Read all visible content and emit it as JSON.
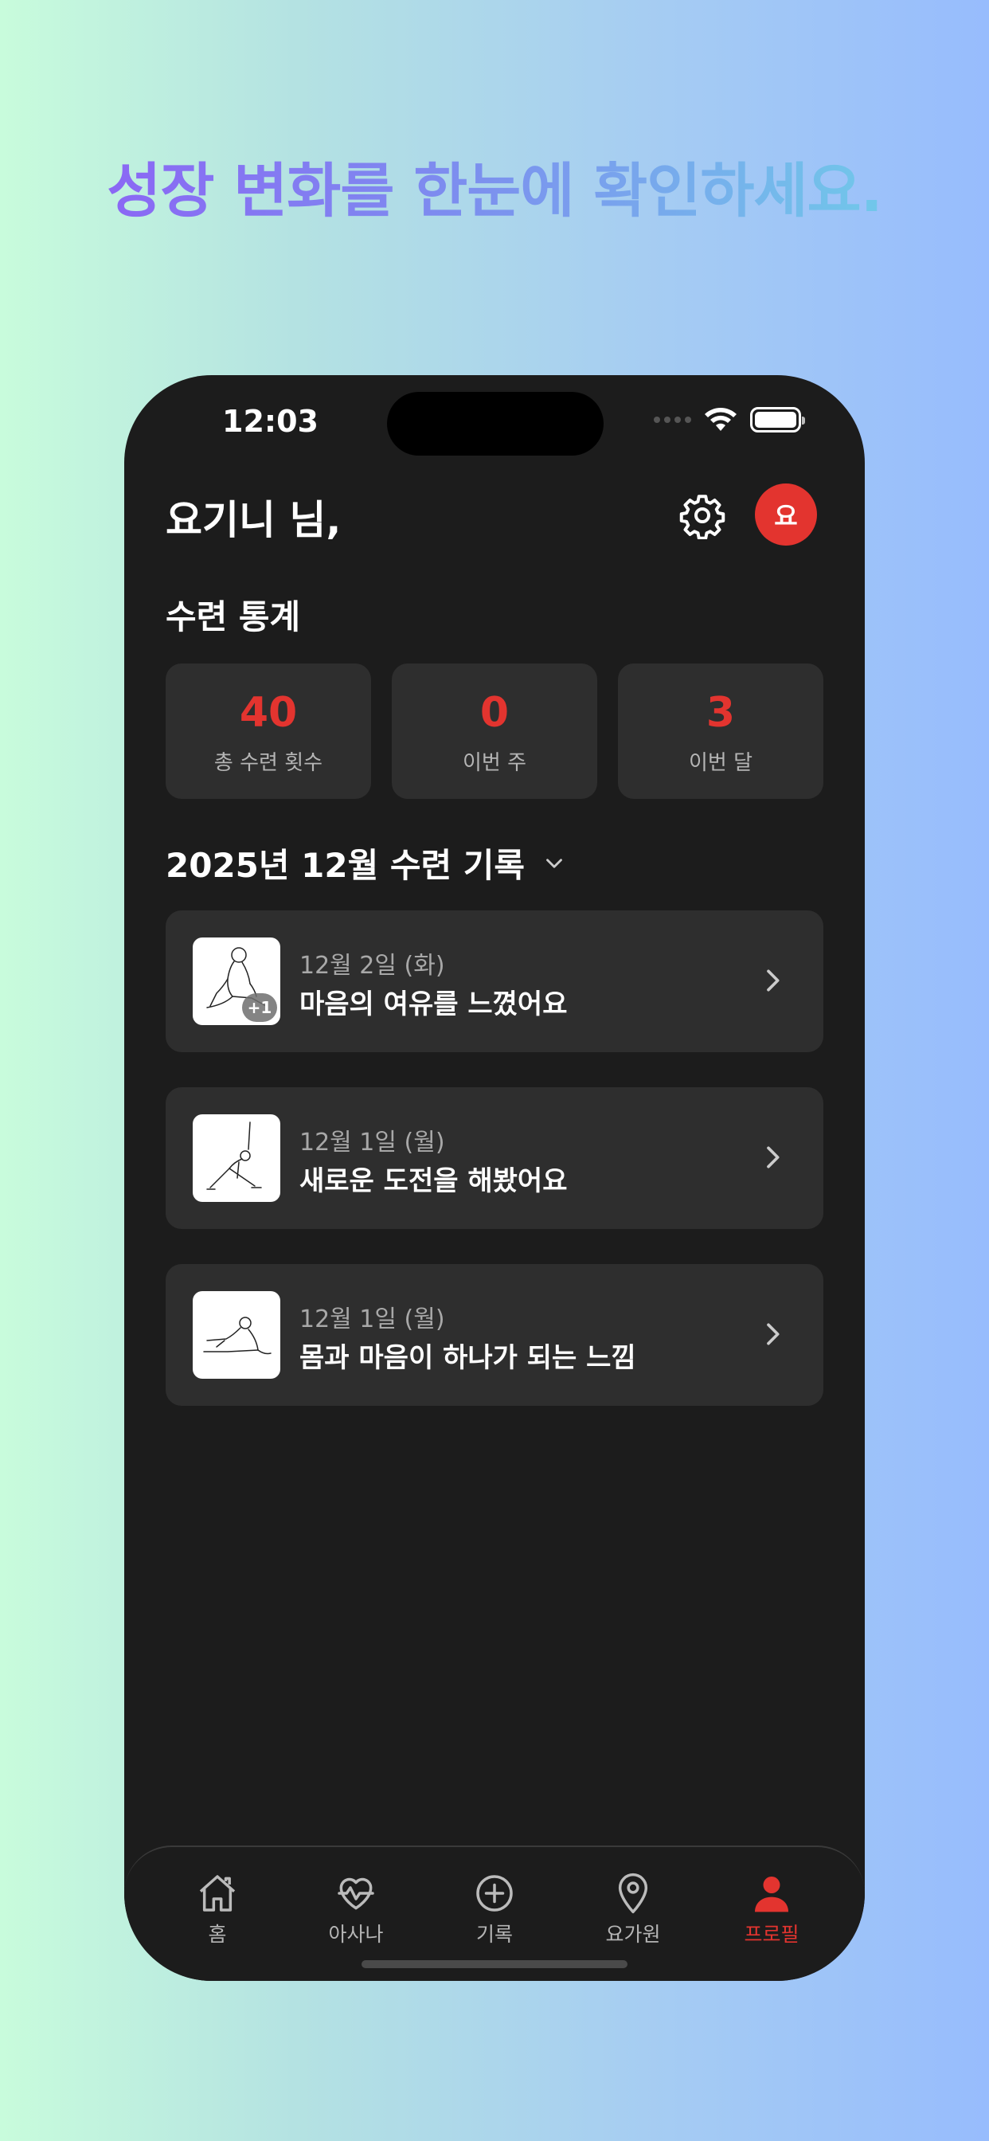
{
  "headline": "성장 변화를 한눈에 확인하세요.",
  "status_bar": {
    "time": "12:03"
  },
  "header": {
    "greeting": "요기니 님,",
    "avatar_initial": "요"
  },
  "stats": {
    "title": "수련 통계",
    "items": [
      {
        "value": "40",
        "label": "총 수련 횟수"
      },
      {
        "value": "0",
        "label": "이번 주"
      },
      {
        "value": "3",
        "label": "이번 달"
      }
    ]
  },
  "records": {
    "month_title": "2025년 12월 수련 기록",
    "items": [
      {
        "date": "12월 2일 (화)",
        "title": "마음의 여유를 느꼈어요",
        "extra_count": "+1"
      },
      {
        "date": "12월 1일 (월)",
        "title": "새로운 도전을 해봤어요"
      },
      {
        "date": "12월 1일 (월)",
        "title": "몸과 마음이 하나가 되는 느낌"
      }
    ]
  },
  "tabbar": {
    "items": [
      {
        "label": "홈",
        "icon": "home-icon"
      },
      {
        "label": "아사나",
        "icon": "heart-pulse-icon"
      },
      {
        "label": "기록",
        "icon": "plus-circle-icon"
      },
      {
        "label": "요가원",
        "icon": "location-pin-icon"
      },
      {
        "label": "프로필",
        "icon": "person-icon",
        "active": true
      }
    ]
  },
  "colors": {
    "accent": "#e3342f",
    "background": "#1c1c1c",
    "card": "#2e2e2e"
  }
}
